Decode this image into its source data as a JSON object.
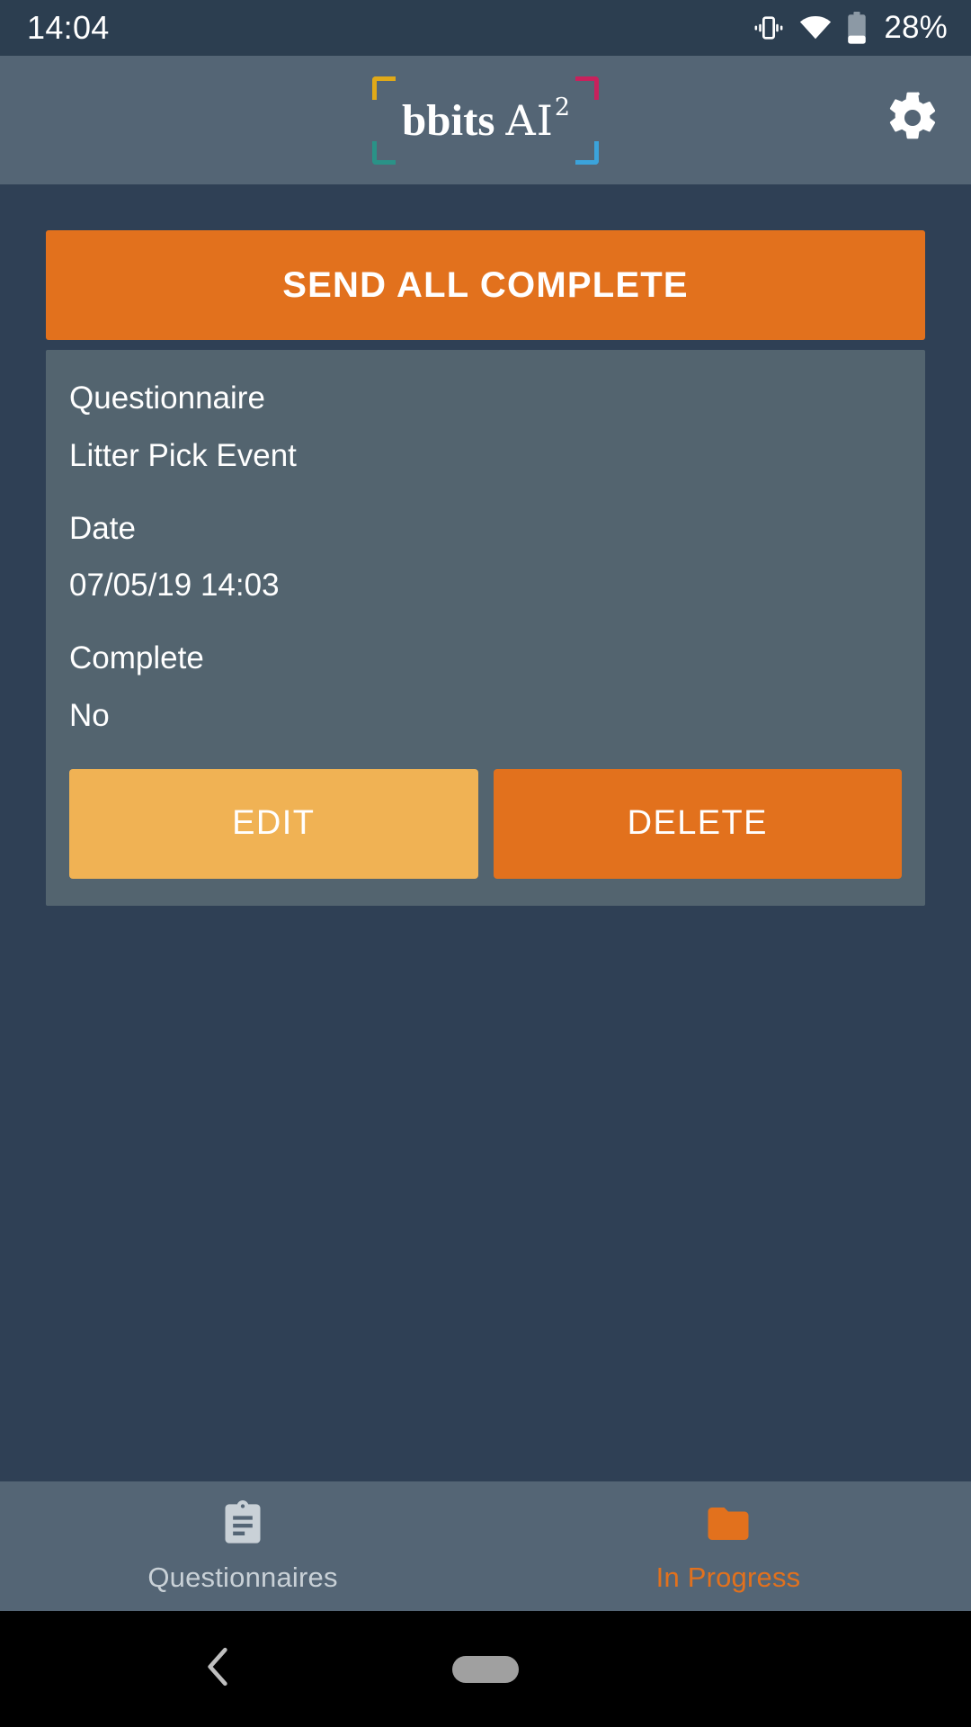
{
  "status_bar": {
    "time": "14:04",
    "battery_percent": "28%",
    "icons": [
      "vibrate-icon",
      "wifi-icon",
      "battery-icon"
    ]
  },
  "header": {
    "logo_primary": "bbits",
    "logo_secondary": "AI",
    "logo_superscript": "2",
    "settings_icon": "gear-icon",
    "bracket_colors": {
      "top_left": "#E0A918",
      "top_right": "#C8215C",
      "bottom_left": "#2A9287",
      "bottom_right": "#3BA3DB"
    }
  },
  "main": {
    "send_all_label": "SEND ALL COMPLETE",
    "record": {
      "questionnaire_label": "Questionnaire",
      "questionnaire_value": "Litter Pick Event",
      "date_label": "Date",
      "date_value": "07/05/19 14:03",
      "complete_label": "Complete",
      "complete_value": "No",
      "edit_label": "EDIT",
      "delete_label": "DELETE"
    }
  },
  "tab_bar": {
    "tabs": [
      {
        "label": "Questionnaires",
        "icon": "clipboard-icon",
        "active": false
      },
      {
        "label": "In Progress",
        "icon": "folder-icon",
        "active": true
      }
    ]
  },
  "nav_bar": {
    "back_icon": "back-chevron-icon",
    "home_icon": "home-pill-icon"
  },
  "colors": {
    "accent_orange": "#E2711D",
    "accent_amber": "#F0B254",
    "page_background": "#2F4055",
    "header_background": "#546575",
    "card_background": "#53646F",
    "status_background": "#2C3E50"
  }
}
